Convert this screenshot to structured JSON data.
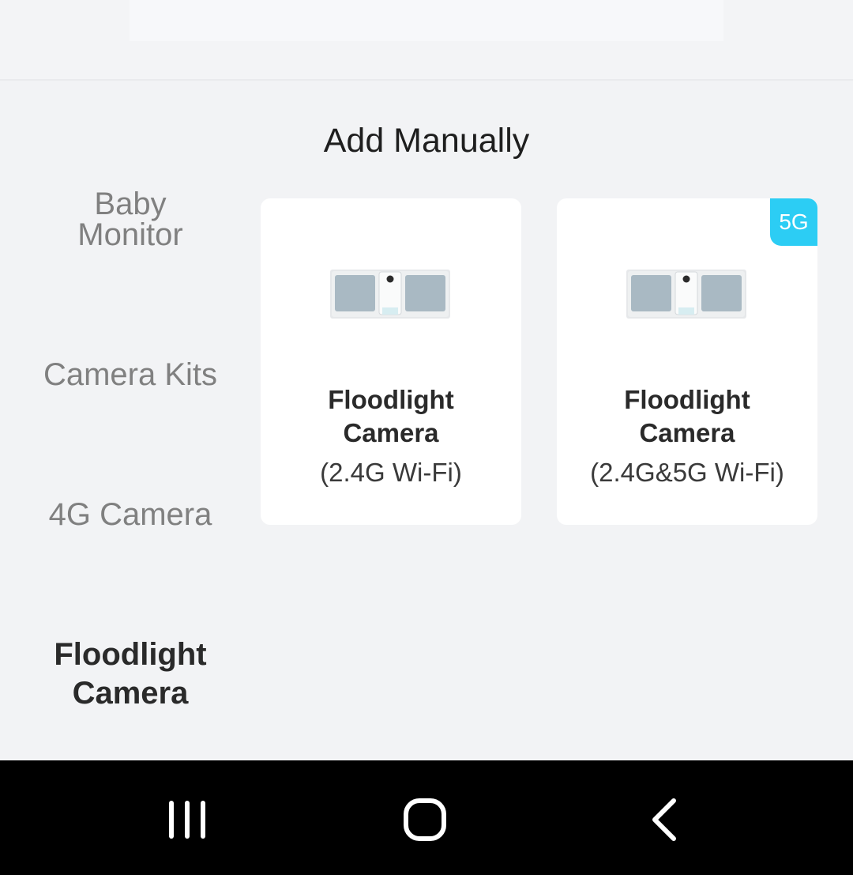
{
  "section_title": "Add Manually",
  "sidebar": {
    "items": [
      {
        "label": "Baby"
      },
      {
        "label": "Monitor"
      },
      {
        "label": "Camera Kits"
      },
      {
        "label": "4G Camera"
      },
      {
        "label": "Floodlight"
      },
      {
        "label": "Camera"
      }
    ]
  },
  "products": [
    {
      "name_line1": "Floodlight",
      "name_line2": "Camera",
      "subtitle": "(2.4G Wi-Fi)",
      "icon": "floodlight-camera-icon"
    },
    {
      "name_line1": "Floodlight",
      "name_line2": "Camera",
      "subtitle": "(2.4G&5G Wi-Fi)",
      "badge": "5G",
      "icon": "floodlight-camera-icon"
    }
  ],
  "colors": {
    "badge": "#2ccdf4",
    "background": "#f2f3f5",
    "nav_bar": "#000000"
  },
  "nav": {
    "recents_icon": "recent-apps-icon",
    "home_icon": "home-icon",
    "back_icon": "back-icon"
  }
}
